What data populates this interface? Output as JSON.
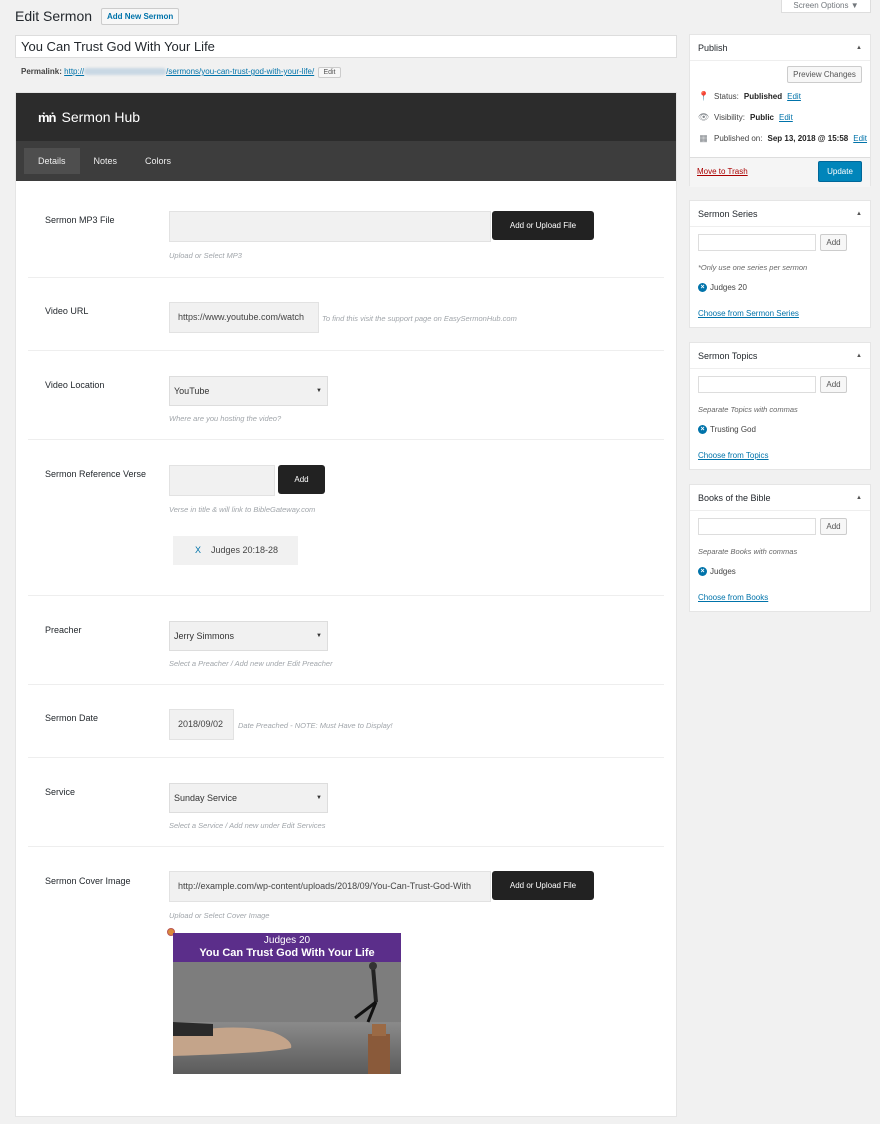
{
  "screen_options": "Screen Options ▼",
  "page_title": "Edit Sermon",
  "add_new": "Add New Sermon",
  "title_value": "You Can Trust God With Your Life",
  "permalink": {
    "label": "Permalink:",
    "url_prefix": "http://",
    "url_path": "/sermons/you-can-trust-god-with-your-life/",
    "edit": "Edit"
  },
  "hub": {
    "brand": "Sermon Hub",
    "tabs": [
      "Details",
      "Notes",
      "Colors"
    ]
  },
  "fields": {
    "mp3": {
      "label": "Sermon MP3 File",
      "button": "Add or Upload File",
      "help": "Upload or Select MP3"
    },
    "video_url": {
      "label": "Video URL",
      "value": "https://www.youtube.com/watch",
      "help": "To find this visit the support page on EasySermonHub.com"
    },
    "video_location": {
      "label": "Video Location",
      "value": "YouTube",
      "help": "Where are you hosting the video?"
    },
    "reference": {
      "label": "Sermon Reference Verse",
      "button": "Add",
      "help": "Verse in title & will link to BibleGateway.com",
      "tag_x": "X",
      "tag": "Judges 20:18-28"
    },
    "preacher": {
      "label": "Preacher",
      "value": "Jerry Simmons",
      "help": "Select a Preacher / Add new under Edit Preacher"
    },
    "date": {
      "label": "Sermon Date",
      "value": "2018/09/02",
      "help": "Date Preached - NOTE: Must Have to Display!"
    },
    "service": {
      "label": "Service",
      "value": "Sunday Service",
      "help": "Select a Service / Add new under Edit Services"
    },
    "cover": {
      "label": "Sermon Cover Image",
      "value": "http://example.com/wp-content/uploads/2018/09/You-Can-Trust-God-With",
      "button": "Add or Upload File",
      "help": "Upload or Select Cover Image",
      "image_line1": "Judges 20",
      "image_line2": "You Can Trust God With Your Life"
    }
  },
  "publish": {
    "title": "Publish",
    "preview": "Preview Changes",
    "status_label": "Status:",
    "status_value": "Published",
    "visibility_label": "Visibility:",
    "visibility_value": "Public",
    "published_label": "Published on:",
    "published_value": "Sep 13, 2018 @ 15:58",
    "edit": "Edit",
    "trash": "Move to Trash",
    "update": "Update"
  },
  "series": {
    "title": "Sermon Series",
    "add": "Add",
    "note": "*Only use one series per sermon",
    "item": "Judges 20",
    "choose": "Choose from Sermon Series"
  },
  "topics": {
    "title": "Sermon Topics",
    "add": "Add",
    "note": "Separate Topics with commas",
    "item": "Trusting God",
    "choose": "Choose from Topics"
  },
  "books": {
    "title": "Books of the Bible",
    "add": "Add",
    "note": "Separate Books with commas",
    "item": "Judges",
    "choose": "Choose from Books"
  },
  "colors": {
    "accent": "#0073aa",
    "primary_button": "#0085ba",
    "hub_header": "#2c2c2c",
    "hub_tabs": "#3d3d3d",
    "trash": "#a00"
  }
}
